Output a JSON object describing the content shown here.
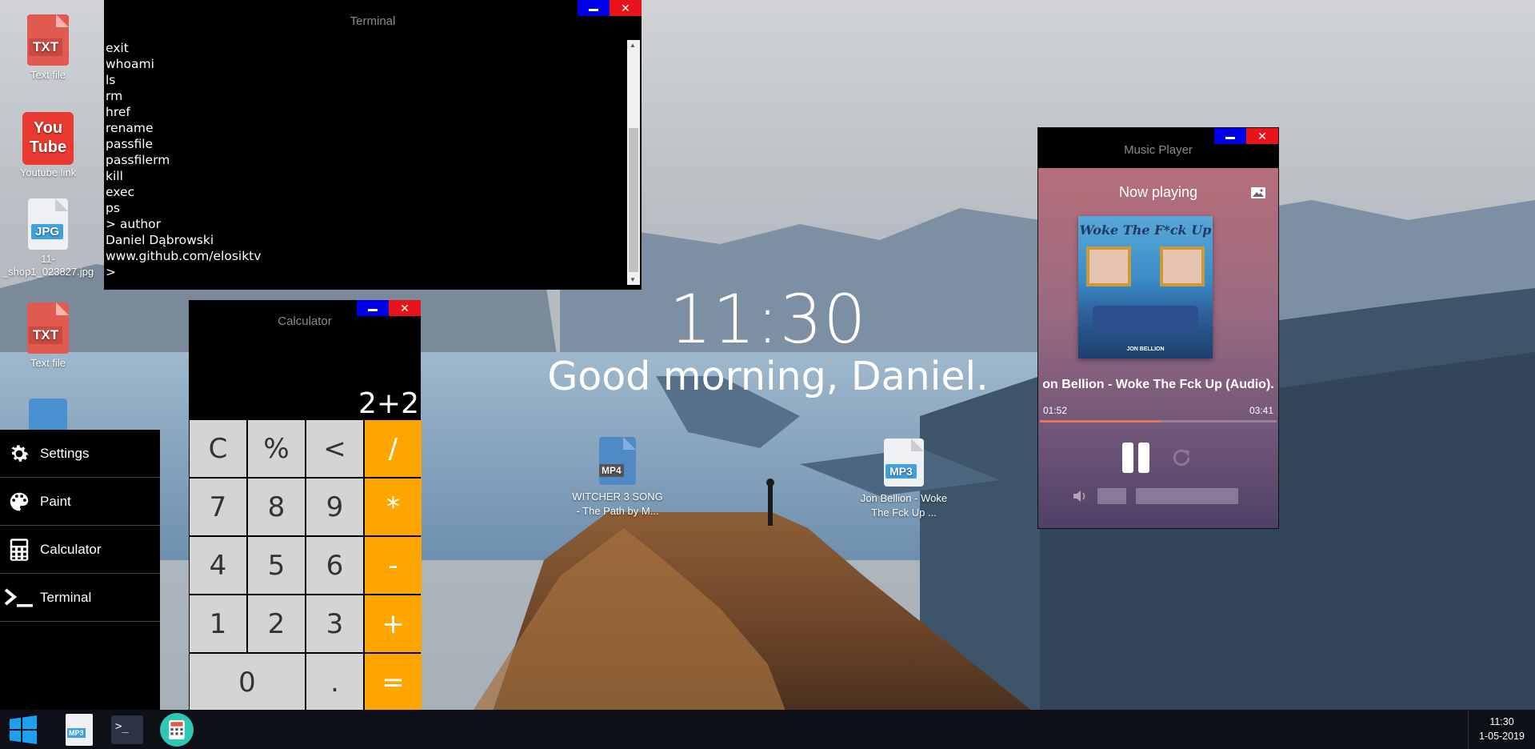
{
  "colors": {
    "min_button": "#0000e8",
    "close_button": "#e8141c",
    "calc_operator": "#ffa500",
    "txt_icon": "#e05a50",
    "jpg_badge": "#3fa2e0",
    "mp3_badge": "#3fa2e0",
    "mp4_file": "#4f8ac4",
    "progress_fill": "#e8735b"
  },
  "desktop": {
    "icons": [
      {
        "type": "TXT",
        "label": "Text file"
      },
      {
        "type": "youtube",
        "label": "Youtube link"
      },
      {
        "type": "JPG",
        "label": "11-_shop1_023827.jpg"
      },
      {
        "type": "TXT",
        "label": "Text file"
      },
      {
        "type": "MP4",
        "label": "WITCHER 3 SONG - The Path by M..."
      },
      {
        "type": "MP3",
        "label": "Jon Bellion - Woke The Fck Up ..."
      }
    ],
    "youtube_logo_top": "You",
    "youtube_logo_bottom": "Tube"
  },
  "terminal": {
    "title": "Terminal",
    "min_glyph": "",
    "close_glyph": "✕",
    "lines": [
      "exit",
      "whoami",
      "ls",
      "rm",
      "href",
      "rename",
      "passfile",
      "passfilerm",
      "kill",
      "exec",
      "ps",
      "> author",
      "Daniel Dąbrowski",
      "www.github.com/elosiktv",
      ">"
    ]
  },
  "calculator": {
    "title": "Calculator",
    "close_glyph": "✕",
    "expression": "2+2",
    "keys": [
      {
        "label": "C",
        "op": false
      },
      {
        "label": "%",
        "op": false
      },
      {
        "label": "<",
        "op": false
      },
      {
        "label": "/",
        "op": true
      },
      {
        "label": "7",
        "op": false
      },
      {
        "label": "8",
        "op": false
      },
      {
        "label": "9",
        "op": false
      },
      {
        "label": "*",
        "op": true
      },
      {
        "label": "4",
        "op": false
      },
      {
        "label": "5",
        "op": false
      },
      {
        "label": "6",
        "op": false
      },
      {
        "label": "-",
        "op": true
      },
      {
        "label": "1",
        "op": false
      },
      {
        "label": "2",
        "op": false
      },
      {
        "label": "3",
        "op": false
      },
      {
        "label": "+",
        "op": true
      },
      {
        "label": "0",
        "op": false,
        "wide": true
      },
      {
        "label": ".",
        "op": false
      },
      {
        "label": "=",
        "op": true
      }
    ]
  },
  "start_menu": {
    "items": [
      {
        "label": "Settings",
        "icon": "gear-icon"
      },
      {
        "label": "Paint",
        "icon": "palette-icon"
      },
      {
        "label": "Calculator",
        "icon": "calculator-icon"
      },
      {
        "label": "Terminal",
        "icon": "terminal-icon"
      }
    ]
  },
  "clock": {
    "time": "11:30",
    "greeting": "Good morning, Daniel."
  },
  "music_player": {
    "title": "Music Player",
    "close_glyph": "✕",
    "now_playing": "Now playing",
    "track": "on Bellion - Woke The Fck Up (Audio).",
    "elapsed": "01:52",
    "duration": "03:41",
    "progress": 0.51,
    "cover_title": "Woke The F*ck Up",
    "cover_artist": "JON BELLION"
  },
  "taskbar": {
    "apps": [
      {
        "name": "windows-start",
        "icon": "windows-icon"
      },
      {
        "name": "mp3",
        "icon": "mp3-file-icon",
        "badge": "MP3"
      },
      {
        "name": "terminal",
        "icon": "terminal-icon",
        "glyph": ">_"
      },
      {
        "name": "calculator",
        "icon": "calculator-icon"
      }
    ],
    "time": "11:30",
    "date": "1-05-2019"
  }
}
